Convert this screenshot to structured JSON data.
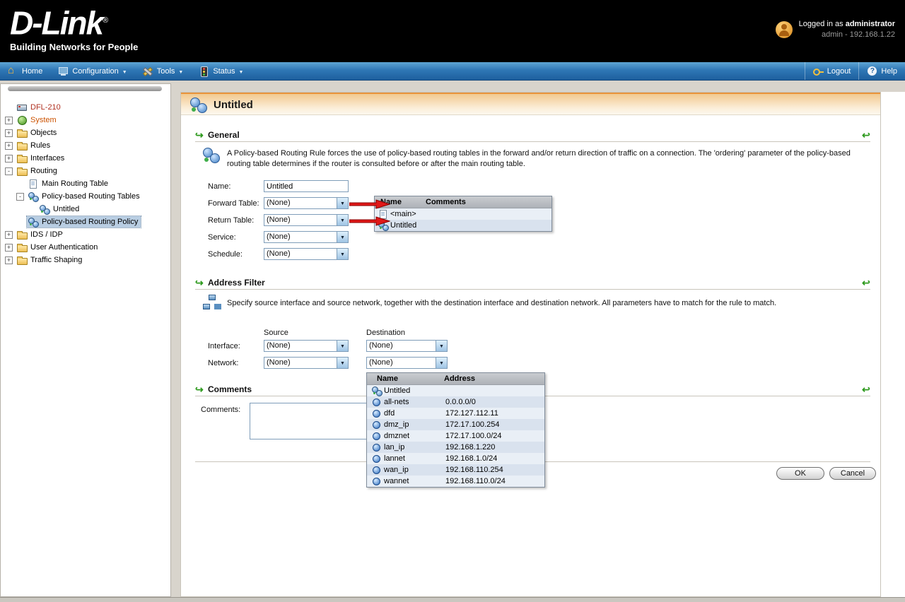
{
  "header": {
    "logo_title": "D-Link",
    "logo_reg": "®",
    "logo_subtitle": "Building Networks for People",
    "logged_in_prefix": "Logged in as",
    "logged_in_user": "administrator",
    "admin_line": "admin - 192.168.1.22"
  },
  "nav": {
    "left": [
      {
        "label": "Home",
        "icon": "home-icon",
        "dropdown": false
      },
      {
        "label": "Configuration",
        "icon": "configuration-icon",
        "dropdown": true
      },
      {
        "label": "Tools",
        "icon": "tools-icon",
        "dropdown": true
      },
      {
        "label": "Status",
        "icon": "status-icon",
        "dropdown": true
      }
    ],
    "right": [
      {
        "label": "Logout",
        "icon": "logout-icon",
        "dropdown": false
      },
      {
        "label": "Help",
        "icon": "help-icon",
        "dropdown": false
      }
    ]
  },
  "sidebar": {
    "items": [
      {
        "label": "DFL-210",
        "level": 0,
        "expander": "",
        "icon": "device-icon",
        "color": "#b03020"
      },
      {
        "label": "System",
        "level": 0,
        "expander": "+",
        "icon": "system-icon",
        "color": "#cc5200"
      },
      {
        "label": "Objects",
        "level": 0,
        "expander": "+",
        "icon": "folder-icon"
      },
      {
        "label": "Rules",
        "level": 0,
        "expander": "+",
        "icon": "folder-icon"
      },
      {
        "label": "Interfaces",
        "level": 0,
        "expander": "+",
        "icon": "folder-icon"
      },
      {
        "label": "Routing",
        "level": 0,
        "expander": "-",
        "icon": "folder-icon"
      },
      {
        "label": "Main Routing Table",
        "level": 1,
        "expander": "",
        "icon": "page-icon"
      },
      {
        "label": "Policy-based Routing Tables",
        "level": 1,
        "expander": "-",
        "icon": "globes-icon"
      },
      {
        "label": "Untitled",
        "level": 2,
        "expander": "",
        "icon": "globes-icon"
      },
      {
        "label": "Policy-based Routing Policy",
        "level": 1,
        "expander": "",
        "icon": "globes-icon",
        "selected": true
      },
      {
        "label": "IDS / IDP",
        "level": 0,
        "expander": "+",
        "icon": "folder-icon"
      },
      {
        "label": "User Authentication",
        "level": 0,
        "expander": "+",
        "icon": "folder-icon"
      },
      {
        "label": "Traffic Shaping",
        "level": 0,
        "expander": "+",
        "icon": "folder-icon"
      }
    ]
  },
  "page": {
    "title": "Untitled"
  },
  "general": {
    "heading": "General",
    "description": "A Policy-based Routing Rule forces the use of policy-based routing tables in the forward and/or return direction of traffic on a connection. The 'ordering' parameter of the policy-based routing table determines if the router is consulted before or after the main routing table.",
    "fields": [
      {
        "label": "Name:",
        "value": "Untitled"
      },
      {
        "label": "Forward Table:",
        "value": "(None)"
      },
      {
        "label": "Return Table:",
        "value": "(None)"
      },
      {
        "label": "Service:",
        "value": "(None)"
      },
      {
        "label": "Schedule:",
        "value": "(None)"
      }
    ]
  },
  "routing_tables_popup": {
    "columns": [
      "Name",
      "Comments"
    ],
    "rows": [
      {
        "name": "<main>",
        "comments": "",
        "icon": "page-icon"
      },
      {
        "name": "Untitled",
        "comments": "",
        "icon": "globes-icon"
      }
    ]
  },
  "address_filter": {
    "heading": "Address Filter",
    "description": "Specify source interface and source network, together with the destination interface and destination network. All parameters have to match for the rule to match.",
    "source_header": "Source",
    "destination_header": "Destination",
    "rows": [
      {
        "label": "Interface:",
        "source": "(None)",
        "destination": "(None)"
      },
      {
        "label": "Network:",
        "source": "(None)",
        "destination": "(None)"
      }
    ]
  },
  "addresses_popup": {
    "columns": [
      "Name",
      "Address"
    ],
    "rows": [
      {
        "name": "Untitled",
        "address": "",
        "icon": "globes-icon"
      },
      {
        "name": "all-nets",
        "address": "0.0.0.0/0",
        "icon": "address-icon"
      },
      {
        "name": "dfd",
        "address": "172.127.112.11",
        "icon": "address-icon"
      },
      {
        "name": "dmz_ip",
        "address": "172.17.100.254",
        "icon": "address-icon"
      },
      {
        "name": "dmznet",
        "address": "172.17.100.0/24",
        "icon": "address-icon"
      },
      {
        "name": "lan_ip",
        "address": "192.168.1.220",
        "icon": "address-icon"
      },
      {
        "name": "lannet",
        "address": "192.168.1.0/24",
        "icon": "address-icon"
      },
      {
        "name": "wan_ip",
        "address": "192.168.110.254",
        "icon": "address-icon"
      },
      {
        "name": "wannet",
        "address": "192.168.110.0/24",
        "icon": "address-icon"
      }
    ]
  },
  "comments": {
    "heading": "Comments",
    "label": "Comments:",
    "value": ""
  },
  "footer": {
    "ok_label": "OK",
    "cancel_label": "Cancel"
  },
  "colors": {
    "accent_orange": "#e8943a",
    "nav_blue": "#2f77b5",
    "arrow_red": "#e01818",
    "jump_green": "#2e9a1e"
  }
}
